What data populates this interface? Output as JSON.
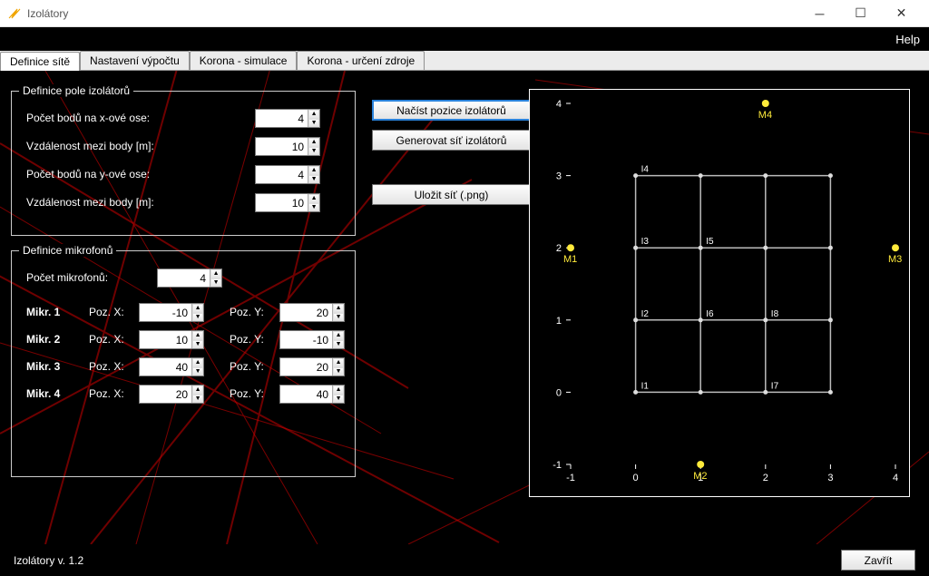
{
  "window": {
    "title": "Izolátory"
  },
  "menubar": {
    "help": "Help"
  },
  "tabs": [
    {
      "label": "Definice sítě",
      "active": true
    },
    {
      "label": "Nastavení výpočtu",
      "active": false
    },
    {
      "label": "Korona - simulace",
      "active": false
    },
    {
      "label": "Korona - určení zdroje",
      "active": false
    }
  ],
  "group_isolators": {
    "legend": "Definice pole izolátorů",
    "rows": [
      {
        "label": "Počet bodů na x-ové ose:",
        "value": "4"
      },
      {
        "label": "Vzdálenost mezi body [m]:",
        "value": "10"
      },
      {
        "label": "Počet bodů na y-ové ose:",
        "value": "4"
      },
      {
        "label": "Vzdálenost mezi body [m]:",
        "value": "10"
      }
    ]
  },
  "buttons": {
    "load": "Načíst pozice izolátorů",
    "generate": "Generovat síť izolátorů",
    "save": "Uložit síť (.png)"
  },
  "group_mics": {
    "legend": "Definice mikrofonů",
    "count_label": "Počet mikrofonů:",
    "count_value": "4",
    "posx_label": "Poz. X:",
    "posy_label": "Poz. Y:",
    "mics": [
      {
        "name": "Mikr. 1",
        "x": "-10",
        "y": "20"
      },
      {
        "name": "Mikr. 2",
        "x": "10",
        "y": "-10"
      },
      {
        "name": "Mikr. 3",
        "x": "40",
        "y": "20"
      },
      {
        "name": "Mikr. 4",
        "x": "20",
        "y": "40"
      }
    ]
  },
  "chart_data": {
    "type": "scatter",
    "xlabel": "",
    "ylabel": "",
    "xlim": [
      -1,
      4
    ],
    "ylim": [
      -1,
      4
    ],
    "xticks": [
      -1,
      0,
      1,
      2,
      3,
      4
    ],
    "yticks": [
      -1,
      0,
      1,
      2,
      3,
      4
    ],
    "microphones": [
      {
        "label": "M1",
        "x": -1,
        "y": 2
      },
      {
        "label": "M2",
        "x": 1,
        "y": -1
      },
      {
        "label": "M3",
        "x": 4,
        "y": 2
      },
      {
        "label": "M4",
        "x": 2,
        "y": 4
      }
    ],
    "isolator_grid": {
      "x_range": [
        0,
        3
      ],
      "y_range": [
        0,
        3
      ],
      "nx": 4,
      "ny": 4,
      "labels": [
        "I1",
        "I2",
        "I3",
        "I4",
        "I5",
        "I6",
        "I7",
        "I8"
      ]
    }
  },
  "footer": {
    "version": "Izolátory v. 1.2",
    "close": "Zavřít"
  }
}
